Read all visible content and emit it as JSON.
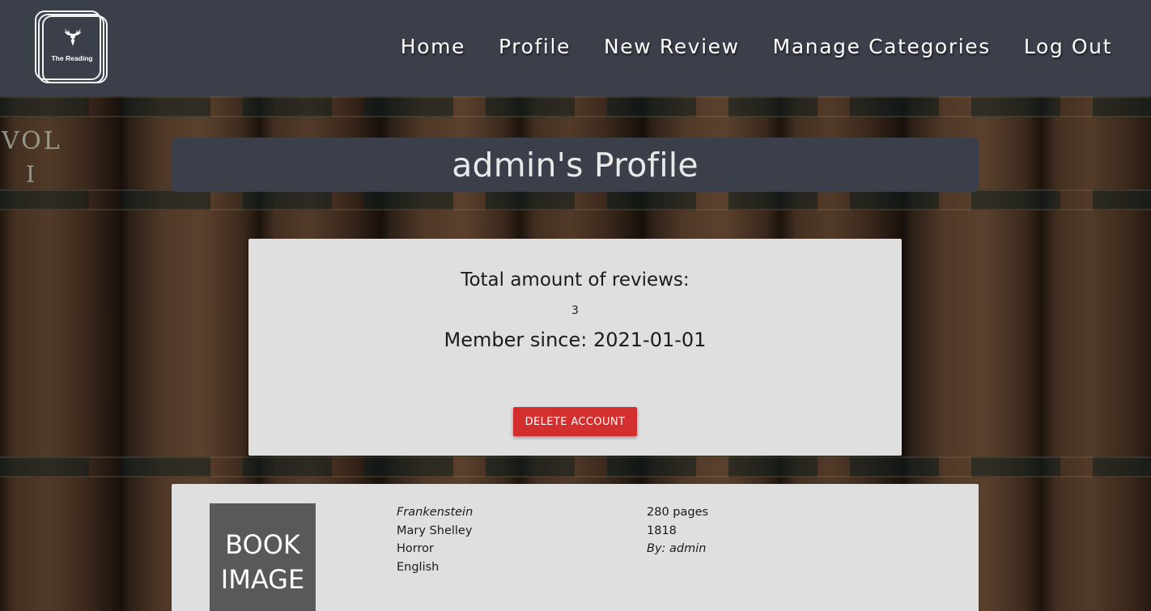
{
  "header": {
    "logo_text": "The Reading",
    "nav": [
      {
        "label": "Home"
      },
      {
        "label": "Profile"
      },
      {
        "label": "New Review"
      },
      {
        "label": "Manage Categories"
      },
      {
        "label": "Log Out"
      }
    ]
  },
  "page": {
    "title": "admin's Profile"
  },
  "stats": {
    "reviews_label": "Total amount of reviews:",
    "reviews_count": "3",
    "member_since": "Member since: 2021-01-01",
    "delete_label": "DELETE ACCOUNT"
  },
  "review": {
    "image_label": "BOOK IMAGE",
    "title": "Frankenstein",
    "author": "Mary Shelley",
    "category": "Horror",
    "language": "English",
    "pages": "280 pages",
    "year": "1818",
    "reviewer": "By: admin"
  },
  "colors": {
    "header_bg": "#3b3f4a",
    "card_bg": "#dfdfdf",
    "danger": "#d32f2f",
    "image_placeholder": "#595959"
  }
}
